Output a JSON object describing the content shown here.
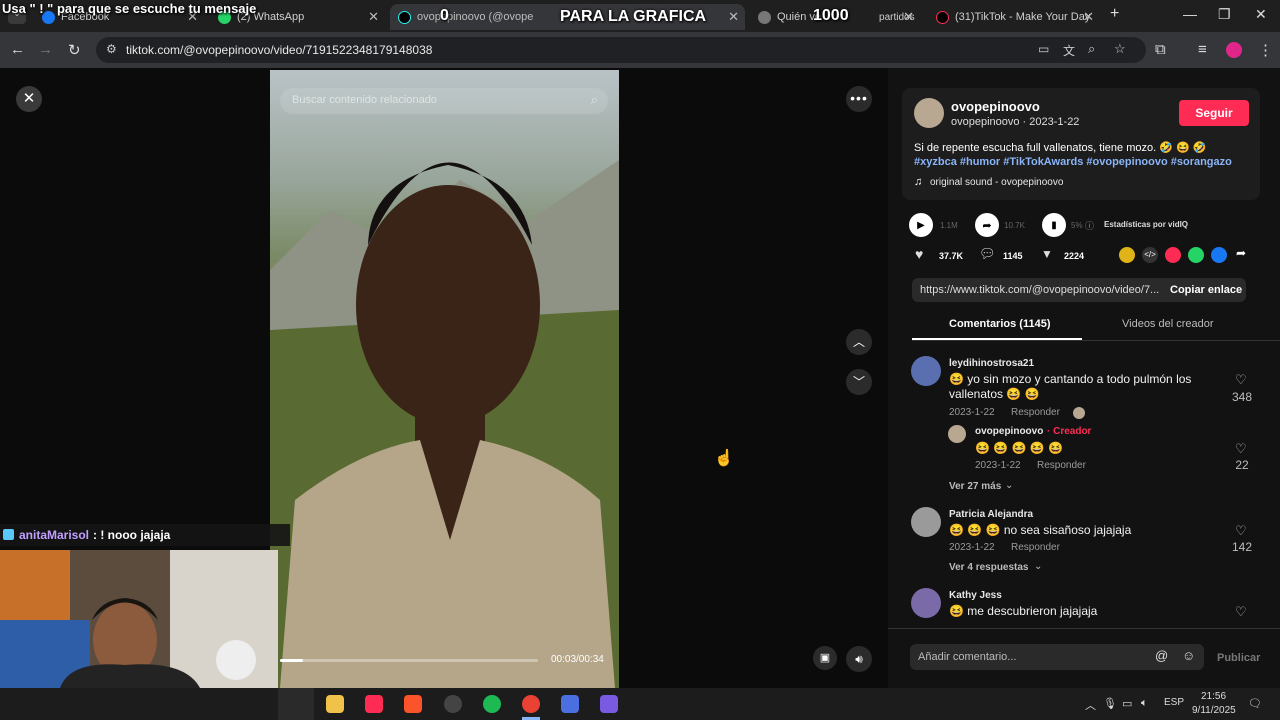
{
  "overlay": {
    "top_message": "Usa \" ! \" para que se escuche tu mensaje",
    "count_a": "0",
    "goal_label": "PARA LA GRAFICA",
    "count_b": "1000",
    "chat_user": "anitaMarisol",
    "chat_message": ": ! nooo jajaja"
  },
  "tabs": [
    {
      "label": "Facebook"
    },
    {
      "label": "(2) WhatsApp"
    },
    {
      "label": "ovopepinoovo (@ovope"
    },
    {
      "label": "Quién ve"
    },
    {
      "label": "partidos"
    },
    {
      "label": "(31)TikTok - Make Your Day"
    }
  ],
  "address": {
    "url": "tiktok.com/@ovopepinoovo/video/7191522348179148038"
  },
  "video": {
    "search_placeholder": "Buscar contenido relacionado",
    "time": "00:03/00:34",
    "progress": 0.09
  },
  "post": {
    "username": "ovopepinoovo",
    "subline": "ovopepinoovo · 2023-1-22",
    "follow_label": "Seguir",
    "caption": "Si de repente escucha full vallenatos, tiene mozo. 🤣 😆 🤣",
    "hashtags": "#xyzbca #humor #TikTokAwards #ovopepinoovo #sorangazo",
    "sound": "original sound - ovopepinoovo",
    "plays": "1.1M",
    "shares": "10.7K",
    "stat_pct": "5%",
    "stats_label": "Estadísticas por vidIQ",
    "likes": "37.7K",
    "comments": "1145",
    "saves": "2224",
    "link": "https://www.tiktok.com/@ovopepinoovo/video/7...",
    "copy_label": "Copiar enlace",
    "tab_comments": "Comentarios (1145)",
    "tab_videos": "Videos del creador"
  },
  "comments": [
    {
      "user": "leydihinostrosa21",
      "text": "😆 yo sin mozo y cantando a todo pulmón los vallenatos 😆 😆",
      "date": "2023-1-22",
      "reply": "Responder",
      "likes": "348"
    },
    {
      "user": "ovopepinoovo",
      "creator": "· Creador",
      "text": "😆 😆 😆 😆 😆",
      "date": "2023-1-22",
      "reply": "Responder",
      "likes": "22"
    },
    {
      "more": "Ver 27 más"
    },
    {
      "user": "Patricia Alejandra",
      "text": "😆 😆 😆 no sea sisañoso jajajaja",
      "date": "2023-1-22",
      "reply": "Responder",
      "likes": "142"
    },
    {
      "more": "Ver 4 respuestas"
    },
    {
      "user": "Kathy Jess",
      "text": "😆 me descubrieron jajajaja"
    }
  ],
  "composer": {
    "placeholder": "Añadir comentario...",
    "post_label": "Publicar"
  },
  "taskbar": {
    "lang": "ESP",
    "time": "21:56",
    "date": "9/11/2025"
  },
  "colors": {
    "follow": "#fe2c55",
    "hashtag": "#8ab4f8",
    "creator": "#fe2c55"
  }
}
